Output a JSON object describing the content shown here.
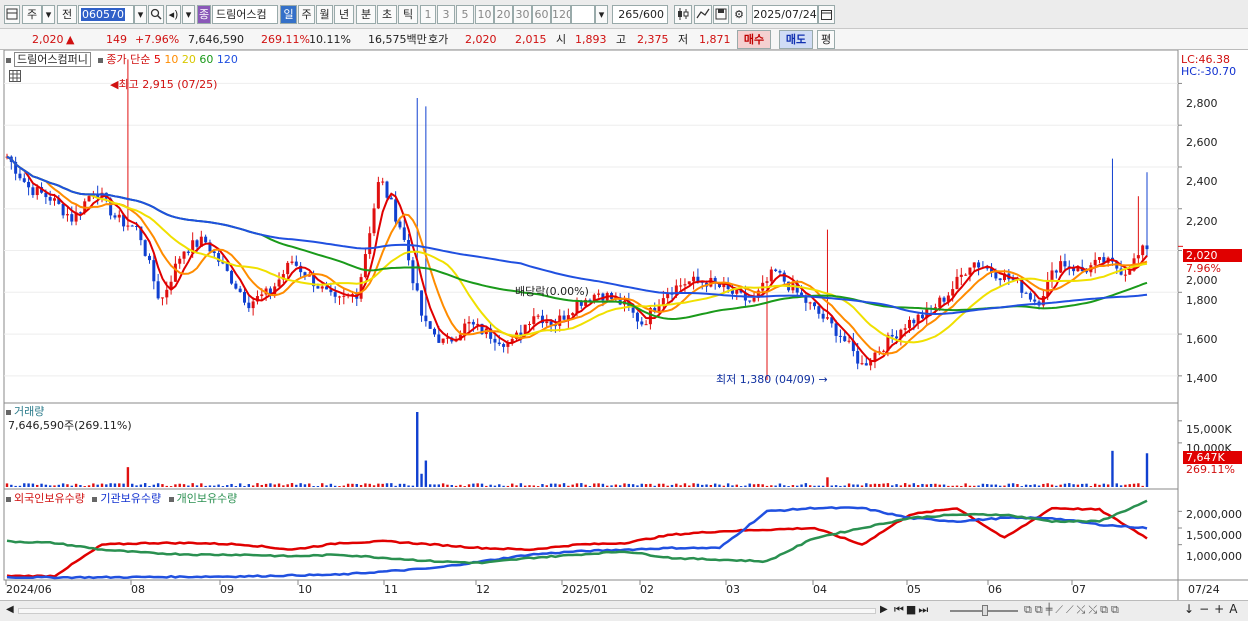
{
  "toolbar": {
    "market": "주",
    "scope": "전",
    "code": "060570",
    "name": "드림어스컴",
    "name_prefix": "종",
    "periods": [
      "일",
      "주",
      "월",
      "년",
      "분",
      "초",
      "틱"
    ],
    "period_active": 0,
    "multipliers": [
      "1",
      "3",
      "5",
      "10",
      "20",
      "30",
      "60",
      "120"
    ],
    "count": "265",
    "count_total": "/600",
    "date": "2025/07/24"
  },
  "quote": {
    "price": "2,020",
    "change": "149",
    "change_pct": "+7.96%",
    "volume": "7,646,590",
    "vol_ratio": "269.11%",
    "turnover": "10.11%",
    "amount": "16,575백만",
    "bid_label": "호가",
    "bid1": "2,020",
    "bid2": "2,015",
    "open_label": "시",
    "open": "1,893",
    "high_label": "고",
    "high": "2,375",
    "low_label": "저",
    "low": "1,871",
    "buy": "매수",
    "sell": "매도",
    "eval": "평"
  },
  "price_panel": {
    "legend_name": "드림어스컴퍼니",
    "legend_ma": "종가 단순",
    "legend_periods": [
      "5",
      "10",
      "20",
      "60",
      "120"
    ],
    "lc": "LC:46.38",
    "hc": "HC:-30.70",
    "current_label": "2,020",
    "current_pct": "7.96%",
    "high_annot": "최고 2,915 (07/25)",
    "low_annot": "최저 1,380 (04/09)",
    "dividend_annot": "배당락(0.00%)"
  },
  "volume_panel": {
    "title": "거래량",
    "value": "7,646,590주(269.11%)",
    "current_label": "7,647K",
    "current_pct": "269.11%"
  },
  "holdings_panel": {
    "legend": [
      "외국인보유수량",
      "기관보유수량",
      "개인보유수량"
    ]
  },
  "chart_data": [
    {
      "type": "candlestick",
      "x": [
        "2024/06",
        "08",
        "09",
        "10",
        "11",
        "12",
        "2025/01",
        "02",
        "03",
        "04",
        "05",
        "06",
        "07"
      ],
      "y_ticks": [
        1400,
        1600,
        1800,
        2000,
        2200,
        2400,
        2600,
        2800
      ],
      "ylim": [
        1270,
        2960
      ],
      "close_approx": [
        2450,
        2300,
        2250,
        2150,
        2300,
        2150,
        2100,
        1750,
        2000,
        2050,
        1900,
        1750,
        1800,
        1950,
        1850,
        1750,
        1800,
        2350,
        2100,
        1650,
        1550,
        1650,
        1600,
        1550,
        1700,
        1650,
        1750,
        1800,
        1750,
        1650,
        1800,
        1850,
        1850,
        1800,
        1750,
        1900,
        1800,
        1700,
        1600,
        1450,
        1550,
        1650,
        1700,
        1800,
        1950,
        1900,
        1850,
        1750,
        1950,
        1900,
        1950,
        1900,
        2020
      ],
      "high": 2915,
      "low": 1380
    },
    {
      "type": "bar",
      "title": "거래량",
      "y_ticks": [
        "15,000K",
        "10,000K"
      ],
      "last_value": 7646590
    },
    {
      "type": "line",
      "series": [
        {
          "name": "외국인보유수량",
          "color": "#e00000"
        },
        {
          "name": "기관보유수량",
          "color": "#2050e0"
        },
        {
          "name": "개인보유수량",
          "color": "#2a9050"
        }
      ],
      "y_ticks": [
        "2,000,000",
        "1,500,000",
        "1,000,000"
      ]
    }
  ],
  "axis": {
    "xlabels": [
      "2024/06",
      "08",
      "09",
      "10",
      "11",
      "12",
      "2025/01",
      "02",
      "03",
      "04",
      "05",
      "06",
      "07"
    ],
    "right_date": "07/24",
    "price_ticks": [
      "2,800",
      "2,600",
      "2,400",
      "2,200",
      "2,000",
      "1,800",
      "1,600",
      "1,400"
    ],
    "vol_ticks": [
      "15,000K",
      "10,000K"
    ],
    "hold_ticks": [
      "2,000,000",
      "1,500,000",
      "1,000,000"
    ]
  },
  "colors": {
    "up": "#e01010",
    "down": "#1040d0",
    "ma5": "#e00000",
    "ma10": "#ff8c00",
    "ma20": "#f0e000",
    "ma60": "#1a9a1a",
    "ma120": "#2050e0",
    "accent": "#7030a0"
  }
}
